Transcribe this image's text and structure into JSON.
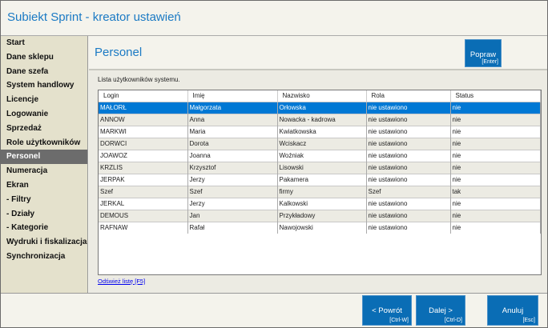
{
  "window": {
    "title": "Subiekt Sprint - kreator ustawień"
  },
  "sidebar": {
    "items": [
      "Start",
      "Dane sklepu",
      "Dane szefa",
      "System handlowy",
      "Licencje",
      "Logowanie",
      "Sprzedaż",
      "Role użytkowników",
      "Personel",
      "Numeracja",
      "Ekran",
      "- Filtry",
      "- Działy",
      "- Kategorie",
      "Wydruki i fiskalizacja",
      "Synchronizacja"
    ],
    "active": "Personel"
  },
  "page": {
    "title": "Personel",
    "description": "Lista użytkowników systemu.",
    "edit_button": {
      "label": "Popraw",
      "shortcut": "[Enter]"
    },
    "refresh_link": "Odśwież listę [F5]"
  },
  "table": {
    "columns": [
      "Login",
      "Imię",
      "Nazwisko",
      "Rola",
      "Status"
    ],
    "rows": [
      [
        "MAŁORŁ",
        "Małgorzata",
        "Orłowska",
        "nie ustawiono",
        "nie"
      ],
      [
        "ANNOW",
        "Anna",
        "Nowacka - kadrowa",
        "nie ustawiono",
        "nie"
      ],
      [
        "MARKWI",
        "Maria",
        "Kwiatkowska",
        "nie ustawiono",
        "nie"
      ],
      [
        "DORWCI",
        "Dorota",
        "Wciskacz",
        "nie ustawiono",
        "nie"
      ],
      [
        "JOAWOZ",
        "Joanna",
        "Woźniak",
        "nie ustawiono",
        "nie"
      ],
      [
        "KRZLIS",
        "Krzysztof",
        "Lisowski",
        "nie ustawiono",
        "nie"
      ],
      [
        "JERPAK",
        "Jerzy",
        "Pakamera",
        "nie ustawiono",
        "nie"
      ],
      [
        "Szef",
        "Szef",
        "firmy",
        "Szef",
        "tak"
      ],
      [
        "JERKAL",
        "Jerzy",
        "Kalkowski",
        "nie ustawiono",
        "nie"
      ],
      [
        "DEMOUS",
        "Jan",
        "Przykładowy",
        "nie ustawiono",
        "nie"
      ],
      [
        "RAFNAW",
        "Rafał",
        "Nawojowski",
        "nie ustawiono",
        "nie"
      ]
    ],
    "selected_row": 0
  },
  "footer": {
    "back": {
      "label": "< Powrót",
      "shortcut": "[Ctrl-W]"
    },
    "next": {
      "label": "Dalej >",
      "shortcut": "[Ctrl-D]"
    },
    "cancel": {
      "label": "Anuluj",
      "shortcut": "[Esc]"
    }
  }
}
